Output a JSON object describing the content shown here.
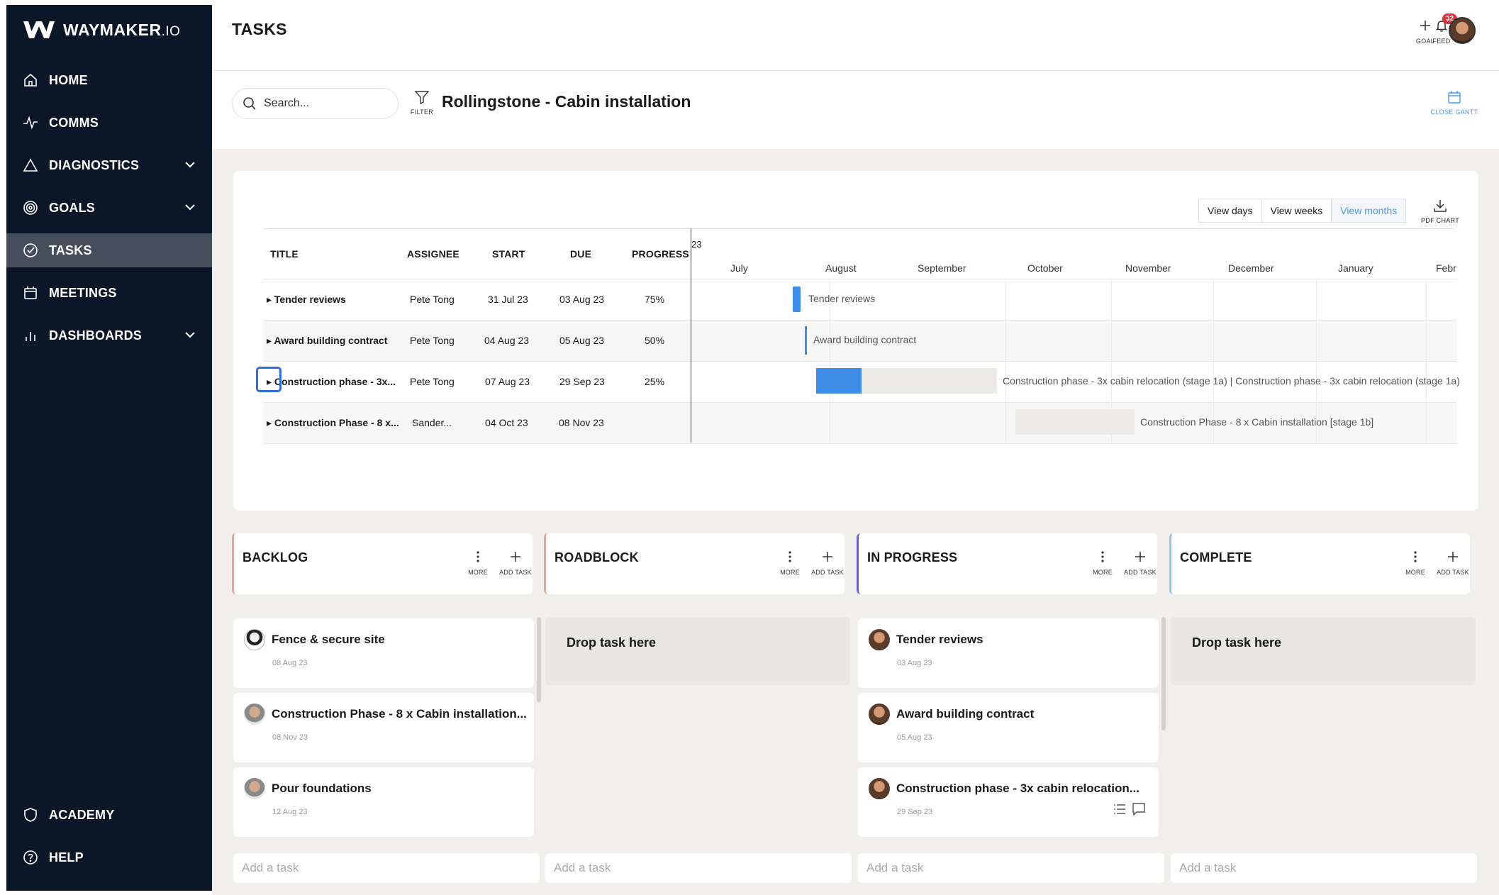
{
  "brand": {
    "name": "WAYMAKER",
    "suffix": ".IO"
  },
  "nav": [
    {
      "label": "HOME",
      "icon": "home-icon",
      "active": false
    },
    {
      "label": "COMMS",
      "icon": "pulse-icon",
      "active": false
    },
    {
      "label": "DIAGNOSTICS",
      "icon": "triangle-icon",
      "active": false,
      "expandable": true
    },
    {
      "label": "GOALS",
      "icon": "target-icon",
      "active": false,
      "expandable": true
    },
    {
      "label": "TASKS",
      "icon": "check-circle-icon",
      "active": true
    },
    {
      "label": "MEETINGS",
      "icon": "calendar-icon",
      "active": false
    },
    {
      "label": "DASHBOARDS",
      "icon": "bar-chart-icon",
      "active": false,
      "expandable": true
    }
  ],
  "nav_bottom": [
    {
      "label": "ACADEMY",
      "icon": "shield-icon"
    },
    {
      "label": "HELP",
      "icon": "help-icon"
    }
  ],
  "header": {
    "title": "TASKS",
    "goal_label": "GOAL",
    "feed_label": "FEED",
    "feed_count": "32"
  },
  "subheader": {
    "search_placeholder": "Search...",
    "filter_label": "FILTER",
    "project_title": "Rollingstone - Cabin installation",
    "close_gantt_label": "CLOSE GANTT"
  },
  "gantt": {
    "view_options": [
      "View days",
      "View weeks",
      "View months"
    ],
    "active_view": "View months",
    "pdf_label": "PDF CHART",
    "columns": [
      "TITLE",
      "ASSIGNEE",
      "START",
      "DUE",
      "PROGRESS"
    ],
    "year_fragment": "23",
    "months": [
      "July",
      "August",
      "September",
      "October",
      "November",
      "December",
      "January",
      "Febr"
    ],
    "rows": [
      {
        "title": "Tender reviews",
        "assignee": "Pete Tong",
        "start": "31 Jul 23",
        "due": "03 Aug 23",
        "progress": "75%",
        "bar_label": "Tender reviews"
      },
      {
        "title": "Award building contract",
        "assignee": "Pete Tong",
        "start": "04 Aug 23",
        "due": "05 Aug 23",
        "progress": "50%",
        "bar_label": "Award building contract"
      },
      {
        "title": "Construction phase - 3x...",
        "assignee": "Pete Tong",
        "start": "07 Aug 23",
        "due": "29 Sep 23",
        "progress": "25%",
        "bar_label": "Construction phase - 3x cabin relocation (stage 1a) | Construction phase - 3x cabin relocation (stage 1a)"
      },
      {
        "title": "Construction Phase - 8 x...",
        "assignee": "Sander...",
        "start": "04 Oct 23",
        "due": "08 Nov 23",
        "progress": "",
        "bar_label": "Construction Phase - 8 x Cabin installation [stage 1b]"
      }
    ]
  },
  "kanban": {
    "more_label": "MORE",
    "add_task_label": "ADD TASK",
    "drop_text": "Drop task here",
    "add_placeholder": "Add a task",
    "columns": [
      {
        "title": "BACKLOG",
        "color": "#e8a39a",
        "cards": [
          {
            "title": "Fence & secure site",
            "date": "08 Aug 23"
          },
          {
            "title": "Construction Phase - 8 x Cabin installation...",
            "date": "08 Nov 23"
          },
          {
            "title": "Pour foundations",
            "date": "12 Aug 23"
          }
        ]
      },
      {
        "title": "ROADBLOCK",
        "color": "#e8a39a",
        "cards": []
      },
      {
        "title": "IN PROGRESS",
        "color": "#6b5fc7",
        "cards": [
          {
            "title": "Tender reviews",
            "date": "03 Aug 23"
          },
          {
            "title": "Award building contract",
            "date": "05 Aug 23"
          },
          {
            "title": "Construction phase - 3x cabin relocation...",
            "date": "29 Sep 23"
          }
        ]
      },
      {
        "title": "COMPLETE",
        "color": "#8ec9e8",
        "cards": []
      }
    ]
  }
}
